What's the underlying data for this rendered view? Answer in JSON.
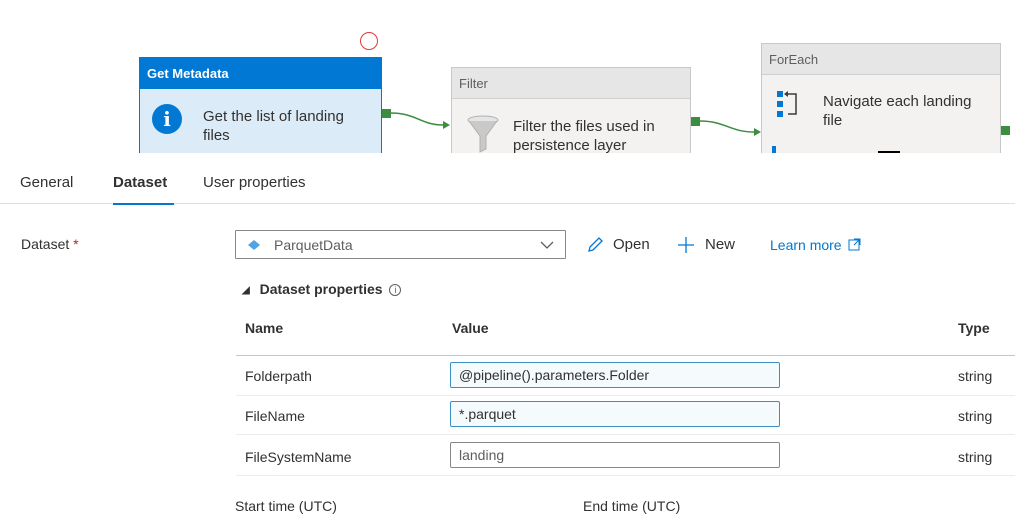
{
  "pipeline": {
    "nodes": [
      {
        "title": "Get Metadata",
        "description_lines": [
          "Get the list of landing",
          "files"
        ],
        "icon": "info-icon",
        "selected": true
      },
      {
        "title": "Filter",
        "description_lines": [
          "Filter the files used in",
          "persistence layer"
        ],
        "icon": "filter-icon",
        "selected": false
      },
      {
        "title": "ForEach",
        "description_lines": [
          "Navigate each landing",
          "file"
        ],
        "icon": "foreach-icon",
        "selected": false
      }
    ],
    "connector_color": "#3c8d40",
    "selection_color": "#0078d4"
  },
  "tabs": [
    {
      "label": "General",
      "active": false
    },
    {
      "label": "Dataset",
      "active": true
    },
    {
      "label": "User properties",
      "active": false
    }
  ],
  "dataset": {
    "label": "Dataset",
    "required_marker": "*",
    "selected_value": "ParquetData",
    "open_label": "Open",
    "new_label": "New",
    "learn_more_label": "Learn more",
    "icons": {
      "dataset": "dataset-icon",
      "dropdown": "chevron-down-icon",
      "open": "pencil-icon",
      "new": "plus-icon",
      "external": "external-link-icon"
    }
  },
  "dataset_properties": {
    "section_title": "Dataset properties",
    "columns": {
      "name": "Name",
      "value": "Value",
      "type": "Type"
    },
    "rows": [
      {
        "name": "Folderpath",
        "value": "@pipeline().parameters.Folder",
        "type": "string"
      },
      {
        "name": "FileName",
        "value": "*.parquet",
        "type": "string"
      },
      {
        "name": "FileSystemName",
        "value": "landing",
        "type": "string"
      }
    ]
  },
  "time_fields": {
    "start_label": "Start time (UTC)",
    "end_label": "End time (UTC)"
  }
}
